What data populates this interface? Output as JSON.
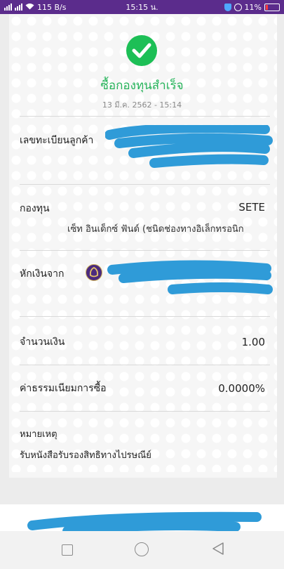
{
  "status_bar": {
    "network": "115 B/s",
    "time": "15:15 น.",
    "battery": "11%"
  },
  "receipt": {
    "status_icon": "check-circle-icon",
    "title": "ซื้อกองทุนสำเร็จ",
    "datetime": "13 มี.ค. 2562 - 15:14",
    "rows": {
      "account": {
        "label": "เลขทะเบียนลูกค้า",
        "value": ""
      },
      "fund": {
        "label": "กองทุน",
        "code": "SETE",
        "name": "เซ็ท อินเด็กซ์ ฟันด์ (ชนิดช่องทางอิเล็กทรอนิก"
      },
      "debit": {
        "label": "หักเงินจาก",
        "bank_icon": "bank-logo-icon"
      },
      "amount": {
        "label": "จำนวนเงิน",
        "value": "1.00"
      },
      "fee": {
        "label": "ค่าธรรมเนียมการซื้อ",
        "value": "0.0000%"
      },
      "note": {
        "label": "หมายเหตุ",
        "value": "รับหนังสือรับรองสิทธิทางไปรษณีย์"
      }
    }
  },
  "colors": {
    "status_bar": "#5b2c8c",
    "success": "#26b35a",
    "redaction": "#2f9bd8",
    "bank_logo": "#4b2a7e"
  },
  "nav": [
    "recent-apps-icon",
    "home-icon",
    "back-icon"
  ]
}
